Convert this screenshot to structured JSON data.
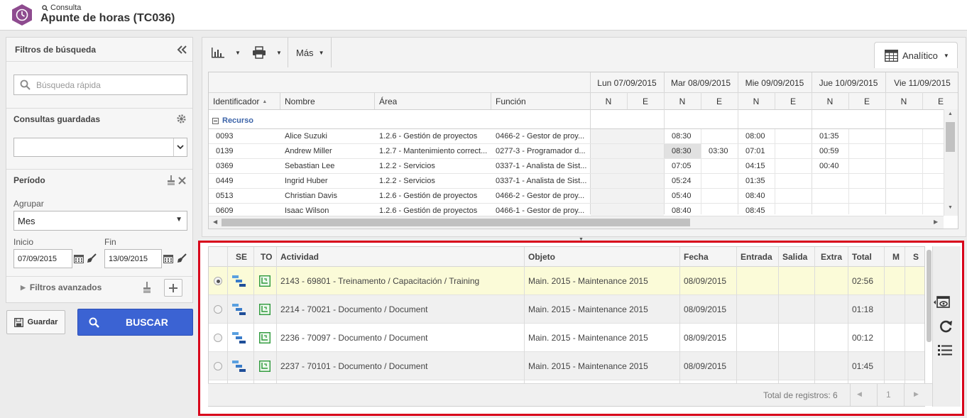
{
  "header": {
    "breadcrumb": "Consulta",
    "title": "Apunte de horas (TC036)"
  },
  "filters": {
    "title": "Filtros de búsqueda",
    "quick_search_placeholder": "Búsqueda rápida",
    "saved_queries_label": "Consultas guardadas",
    "period_label": "Período",
    "group_label": "Agrupar",
    "group_value": "Mes",
    "start_label": "Inicio",
    "start_value": "07/09/2015",
    "end_label": "Fin",
    "end_value": "13/09/2015",
    "advanced_label": "Filtros avanzados",
    "save_label": "Guardar",
    "search_label": "BUSCAR"
  },
  "toolbar": {
    "more_label": "Más",
    "view_label": "Analítico"
  },
  "grid1": {
    "days": [
      "Lun 07/09/2015",
      "Mar 08/09/2015",
      "Mie 09/09/2015",
      "Jue 10/09/2015",
      "Vie 11/09/2015"
    ],
    "columns": [
      "Identificador",
      "Nombre",
      "Área",
      "Función"
    ],
    "ne": [
      "N",
      "E"
    ],
    "group_label": "Recurso",
    "rows": [
      {
        "id": "0093",
        "name": "Alice Suzuki",
        "area": "1.2.6 - Gestión de proyectos",
        "func": "0466-2 - Gestor de proy...",
        "v": [
          "",
          "",
          "08:30",
          "",
          "08:00",
          "",
          "01:35",
          "",
          "",
          ""
        ]
      },
      {
        "id": "0139",
        "name": "Andrew Miller",
        "area": "1.2.7 - Mantenimiento correct...",
        "func": "0277-3 - Programador d...",
        "v": [
          "",
          "",
          "08:30",
          "03:30",
          "07:01",
          "",
          "00:59",
          "",
          "",
          ""
        ]
      },
      {
        "id": "0369",
        "name": "Sebastian Lee",
        "area": "1.2.2 - Servicios",
        "func": "0337-1 - Analista de Sist...",
        "v": [
          "",
          "",
          "07:05",
          "",
          "04:15",
          "",
          "00:40",
          "",
          "",
          ""
        ]
      },
      {
        "id": "0449",
        "name": "Ingrid Huber",
        "area": "1.2.2 - Servicios",
        "func": "0337-1 - Analista de Sist...",
        "v": [
          "",
          "",
          "05:24",
          "",
          "01:35",
          "",
          "",
          "",
          "",
          ""
        ]
      },
      {
        "id": "0513",
        "name": "Christian Davis",
        "area": "1.2.6 - Gestión de proyectos",
        "func": "0466-2 - Gestor de proy...",
        "v": [
          "",
          "",
          "05:40",
          "",
          "08:40",
          "",
          "",
          "",
          "",
          ""
        ]
      },
      {
        "id": "0609",
        "name": "Isaac Wilson",
        "area": "1.2.6 - Gestión de proyectos",
        "func": "0466-1 - Gestor de proy...",
        "v": [
          "",
          "",
          "08:40",
          "",
          "08:45",
          "",
          "",
          "",
          "",
          ""
        ]
      }
    ]
  },
  "grid2": {
    "columns": [
      "SE",
      "TO",
      "Actividad",
      "Objeto",
      "Fecha",
      "Entrada",
      "Salida",
      "Extra",
      "Total",
      "M",
      "S"
    ],
    "rows": [
      {
        "actividad": "2143 - 69801 - Treinamento / Capacitación / Training",
        "objeto": "Main. 2015 - Maintenance 2015",
        "fecha": "08/09/2015",
        "total": "02:56",
        "selected": true
      },
      {
        "actividad": "2214 - 70021 - Documento / Document",
        "objeto": "Main. 2015 - Maintenance 2015",
        "fecha": "08/09/2015",
        "total": "01:18",
        "selected": false
      },
      {
        "actividad": "2236 - 70097 - Documento / Document",
        "objeto": "Main. 2015 - Maintenance 2015",
        "fecha": "08/09/2015",
        "total": "00:12",
        "selected": false
      },
      {
        "actividad": "2237 - 70101 - Documento / Document",
        "objeto": "Main. 2015 - Maintenance 2015",
        "fecha": "08/09/2015",
        "total": "01:45",
        "selected": false
      }
    ],
    "total_records": "Total de registros: 6",
    "page": "1"
  },
  "colors": {
    "accent": "#3b63d3",
    "highlight_border": "#d8001a",
    "selected_row": "#fbfbd8",
    "logo": "#8e4b8f"
  }
}
